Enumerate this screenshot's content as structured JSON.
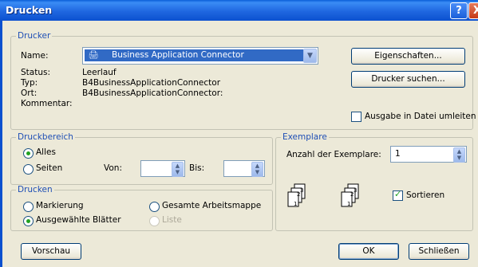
{
  "window": {
    "title": "Drucken",
    "help_label": "?",
    "close_label": "X"
  },
  "drucker": {
    "group_label": "Drucker",
    "name_label": "Name:",
    "name_value": "Business Application Connector",
    "status_label": "Status:",
    "status_value": "Leerlauf",
    "typ_label": "Typ:",
    "typ_value": "B4BusinessApplicationConnector",
    "ort_label": "Ort:",
    "ort_value": "B4BusinessApplicationConnector:",
    "kommentar_label": "Kommentar:",
    "eigenschaften_button": "Eigenschaften...",
    "drucker_suchen_button": "Drucker suchen...",
    "ausgabe_datei_label": "Ausgabe in Datei umleiten"
  },
  "druckbereich": {
    "group_label": "Druckbereich",
    "alles_label": "Alles",
    "seiten_label": "Seiten",
    "von_label": "Von:",
    "bis_label": "Bis:",
    "selected": "alles"
  },
  "drucken": {
    "group_label": "Drucken",
    "markierung_label": "Markierung",
    "gesamte_label": "Gesamte Arbeitsmappe",
    "ausgewaehlte_label": "Ausgewählte Blätter",
    "liste_label": "Liste",
    "selected": "ausgewaehlte"
  },
  "exemplare": {
    "group_label": "Exemplare",
    "anzahl_label": "Anzahl der Exemplare:",
    "anzahl_value": "1",
    "sortieren_label": "Sortieren",
    "sortieren_checked": true
  },
  "footer": {
    "vorschau_button": "Vorschau",
    "ok_button": "OK",
    "schliessen_button": "Schließen"
  }
}
